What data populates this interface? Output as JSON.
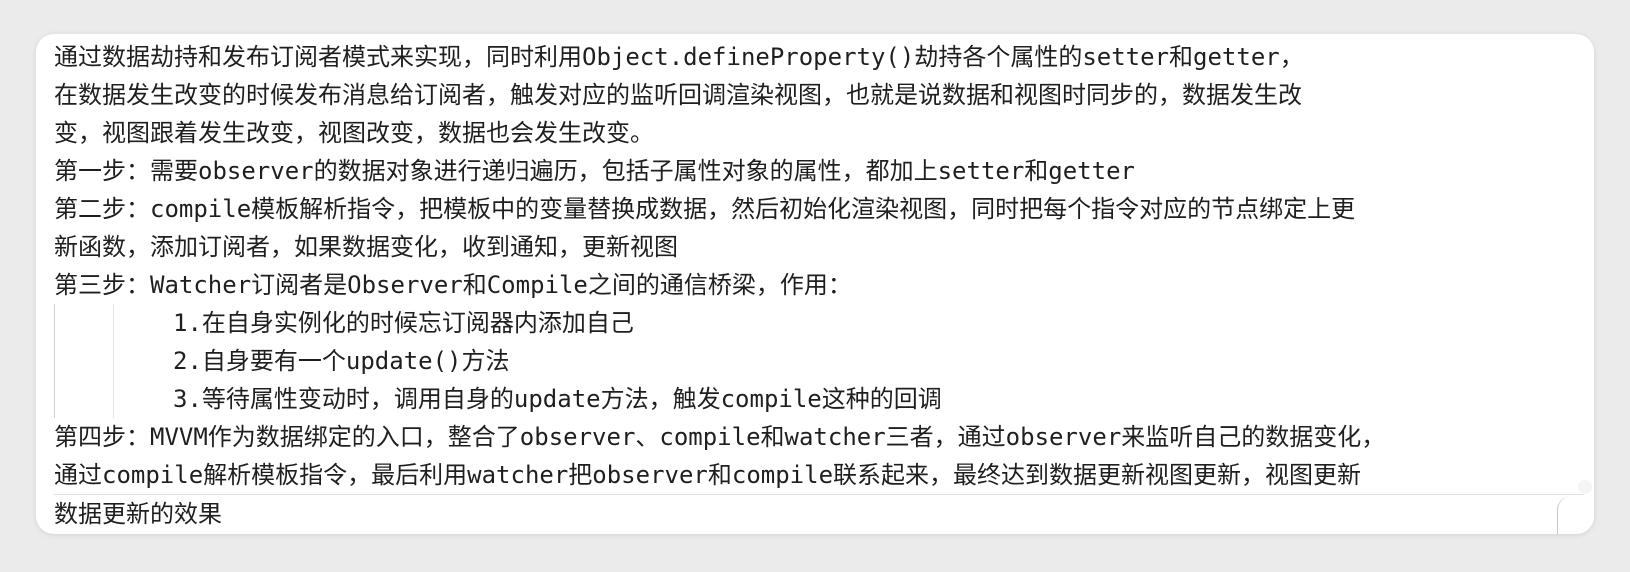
{
  "document": {
    "paragraphs": [
      "通过数据劫持和发布订阅者模式来实现，同时利用Object.defineProperty()劫持各个属性的setter和getter，",
      "在数据发生改变的时候发布消息给订阅者，触发对应的监听回调渲染视图，也就是说数据和视图时同步的，数据发生改",
      "变，视图跟着发生改变，视图改变，数据也会发生改变。",
      "第一步：需要observer的数据对象进行递归遍历，包括子属性对象的属性，都加上setter和getter",
      "第二步：compile模板解析指令，把模板中的变量替换成数据，然后初始化渲染视图，同时把每个指令对应的节点绑定上更",
      "新函数，添加订阅者，如果数据变化，收到通知，更新视图",
      "第三步：Watcher订阅者是Observer和Compile之间的通信桥梁，作用："
    ],
    "list_items": [
      "1.在自身实例化的时候忘订阅器内添加自己",
      "2.自身要有一个update()方法",
      "3.等待属性变动时，调用自身的update方法，触发compile这种的回调"
    ],
    "closing": [
      "第四步：MVVM作为数据绑定的入口，整合了observer、compile和watcher三者，通过observer来监听自己的数据变化，",
      "通过compile解析模板指令，最后利用watcher把observer和compile联系起来，最终达到数据更新视图更新，视图更新",
      "数据更新的效果"
    ]
  }
}
